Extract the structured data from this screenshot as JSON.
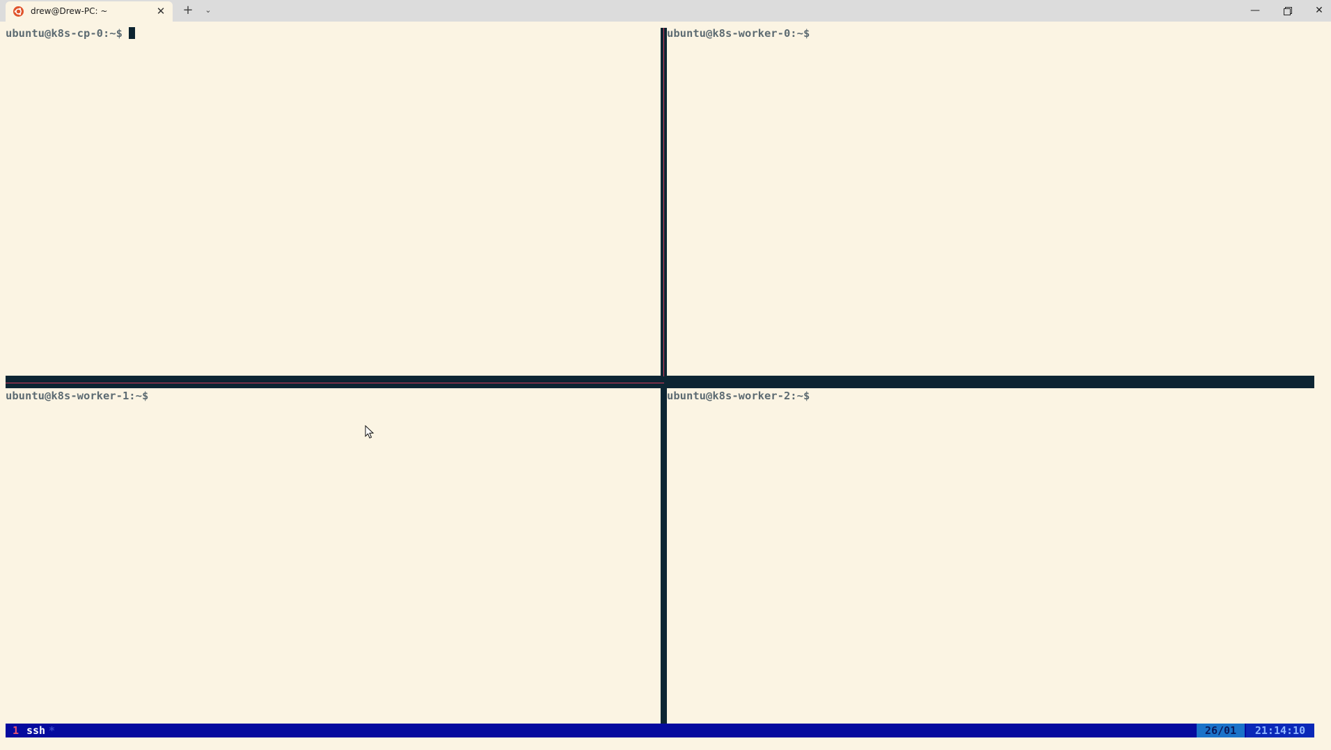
{
  "window": {
    "tab_title": "drew@Drew-PC: ~",
    "tab_icon": "ubuntu-icon",
    "close_tab_glyph": "✕",
    "new_tab_glyph": "+",
    "dropdown_glyph": "⌄",
    "minimize_glyph": "—",
    "close_glyph": "✕"
  },
  "panes": {
    "top_left": {
      "prompt": "ubuntu@k8s-cp-0:~$",
      "active": true
    },
    "top_right": {
      "prompt": "ubuntu@k8s-worker-0:~$"
    },
    "bottom_left": {
      "prompt": "ubuntu@k8s-worker-1:~$"
    },
    "bottom_right": {
      "prompt": "ubuntu@k8s-worker-2:~$"
    }
  },
  "statusbar": {
    "window_index": "1",
    "window_name": "ssh",
    "window_flag": "*",
    "date": "26/01",
    "time": "21:14:10"
  },
  "colors": {
    "background": "#fbf4e3",
    "border": "#0d2533",
    "active_border": "#d63c5b",
    "statusbar": "#050b9e",
    "prompt": "#5d6b72"
  }
}
